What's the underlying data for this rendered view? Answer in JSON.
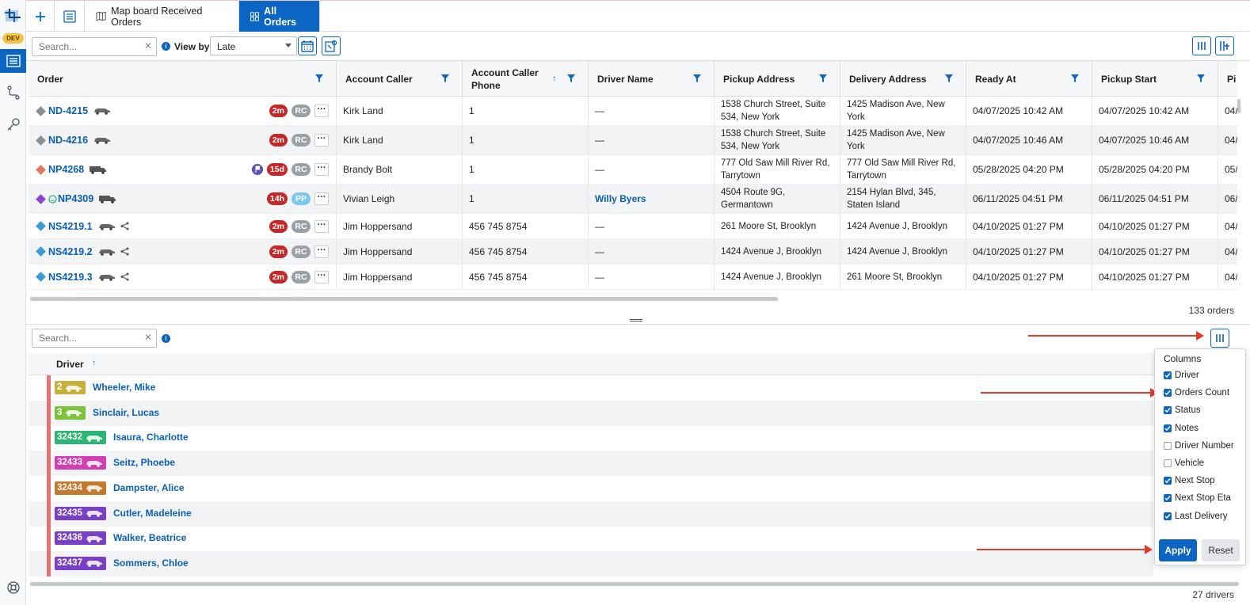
{
  "app": {
    "env_badge": "DEV"
  },
  "tabs": [
    {
      "label": "Map board Received Orders"
    },
    {
      "label": "All Orders"
    }
  ],
  "toolbar": {
    "search_placeholder": "Search...",
    "view_by_label": "View by",
    "view_by_value": "Late"
  },
  "orders": {
    "columns": [
      "Order",
      "Account Caller",
      "Account Caller Phone",
      "Driver Name",
      "Pickup Address",
      "Delivery Address",
      "Ready At",
      "Pickup Start",
      "Pi"
    ],
    "rows": [
      {
        "id": "ND-4215",
        "time": "2m",
        "code": "RC",
        "caller": "Kirk Land",
        "phone": "1",
        "driver": "—",
        "pickup": "1538 Church Street, Suite 534, New York",
        "delivery": "1425 Madison Ave, New York",
        "ready": "04/07/2025 10:42 AM",
        "pickup_start": "04/07/2025 10:42 AM",
        "next": "04/"
      },
      {
        "id": "ND-4216",
        "time": "2m",
        "code": "RC",
        "caller": "Kirk Land",
        "phone": "1",
        "driver": "—",
        "pickup": "1538 Church Street, Suite 534, New York",
        "delivery": "1425 Madison Ave, New York",
        "ready": "04/07/2025 10:46 AM",
        "pickup_start": "04/07/2025 10:46 AM",
        "next": "04/"
      },
      {
        "id": "NP4268",
        "time": "15d",
        "code": "RC",
        "caller": "Brandy Bolt",
        "phone": "1",
        "driver": "—",
        "pickup": "777 Old Saw Mill River Rd, Tarrytown",
        "delivery": "777 Old Saw Mill River Rd, Tarrytown",
        "ready": "05/28/2025 04:20 PM",
        "pickup_start": "05/28/2025 04:20 PM",
        "next": "05/"
      },
      {
        "id": "NP4309",
        "time": "14h",
        "code": "PP",
        "caller": "Vivian Leigh",
        "phone": "1",
        "driver": "Willy Byers",
        "pickup": "4504 Route 9G, Germantown",
        "delivery": "2154 Hylan Blvd, 345, Staten Island",
        "ready": "06/11/2025 04:51 PM",
        "pickup_start": "06/11/2025 04:51 PM",
        "next": "06/"
      },
      {
        "id": "NS4219.1",
        "time": "2m",
        "code": "RC",
        "caller": "Jim Hoppersand",
        "phone": "456 745 8754",
        "driver": "—",
        "pickup": "261 Moore St, Brooklyn",
        "delivery": "1424 Avenue J, Brooklyn",
        "ready": "04/10/2025 01:27 PM",
        "pickup_start": "04/10/2025 01:27 PM",
        "next": "04/"
      },
      {
        "id": "NS4219.2",
        "time": "2m",
        "code": "RC",
        "caller": "Jim Hoppersand",
        "phone": "456 745 8754",
        "driver": "—",
        "pickup": "1424 Avenue J, Brooklyn",
        "delivery": "1424 Avenue J, Brooklyn",
        "ready": "04/10/2025 01:27 PM",
        "pickup_start": "04/10/2025 01:27 PM",
        "next": "04/"
      },
      {
        "id": "NS4219.3",
        "time": "2m",
        "code": "RC",
        "caller": "Jim Hoppersand",
        "phone": "456 745 8754",
        "driver": "—",
        "pickup": "1424 Avenue J, Brooklyn",
        "delivery": "261 Moore St, Brooklyn",
        "ready": "04/10/2025 01:27 PM",
        "pickup_start": "04/10/2025 01:27 PM",
        "next": "04/"
      }
    ],
    "count_label": "133 orders"
  },
  "drivers": {
    "search_placeholder": "Search...",
    "column": "Driver",
    "rows": [
      {
        "num": "2",
        "name": "Wheeler, Mike",
        "color": "#c9b03a"
      },
      {
        "num": "3",
        "name": "Sinclair, Lucas",
        "color": "#7cc23a"
      },
      {
        "num": "32432",
        "name": "Isaura, Charlotte",
        "color": "#2bb673"
      },
      {
        "num": "32433",
        "name": "Seitz, Phoebe",
        "color": "#d23fb5"
      },
      {
        "num": "32434",
        "name": "Dampster, Alice",
        "color": "#c7782f"
      },
      {
        "num": "32435",
        "name": "Cutler, Madeleine",
        "color": "#7a3fc9"
      },
      {
        "num": "32436",
        "name": "Walker, Beatrice",
        "color": "#7a3fc9"
      },
      {
        "num": "32437",
        "name": "Sommers, Chloe",
        "color": "#7a3fc9"
      }
    ],
    "count_label": "27 drivers"
  },
  "columns_popover": {
    "title": "Columns",
    "options": [
      {
        "label": "Driver",
        "checked": true
      },
      {
        "label": "Orders Count",
        "checked": true
      },
      {
        "label": "Status",
        "checked": true
      },
      {
        "label": "Notes",
        "checked": true
      },
      {
        "label": "Driver Number",
        "checked": false
      },
      {
        "label": "Vehicle",
        "checked": false
      },
      {
        "label": "Next Stop",
        "checked": true
      },
      {
        "label": "Next Stop Eta",
        "checked": true
      },
      {
        "label": "Last Delivery",
        "checked": true
      }
    ],
    "apply_label": "Apply",
    "reset_label": "Reset"
  },
  "colors": {
    "primary": "#0a66c2",
    "annotation_arrow": "#e53a2a"
  }
}
